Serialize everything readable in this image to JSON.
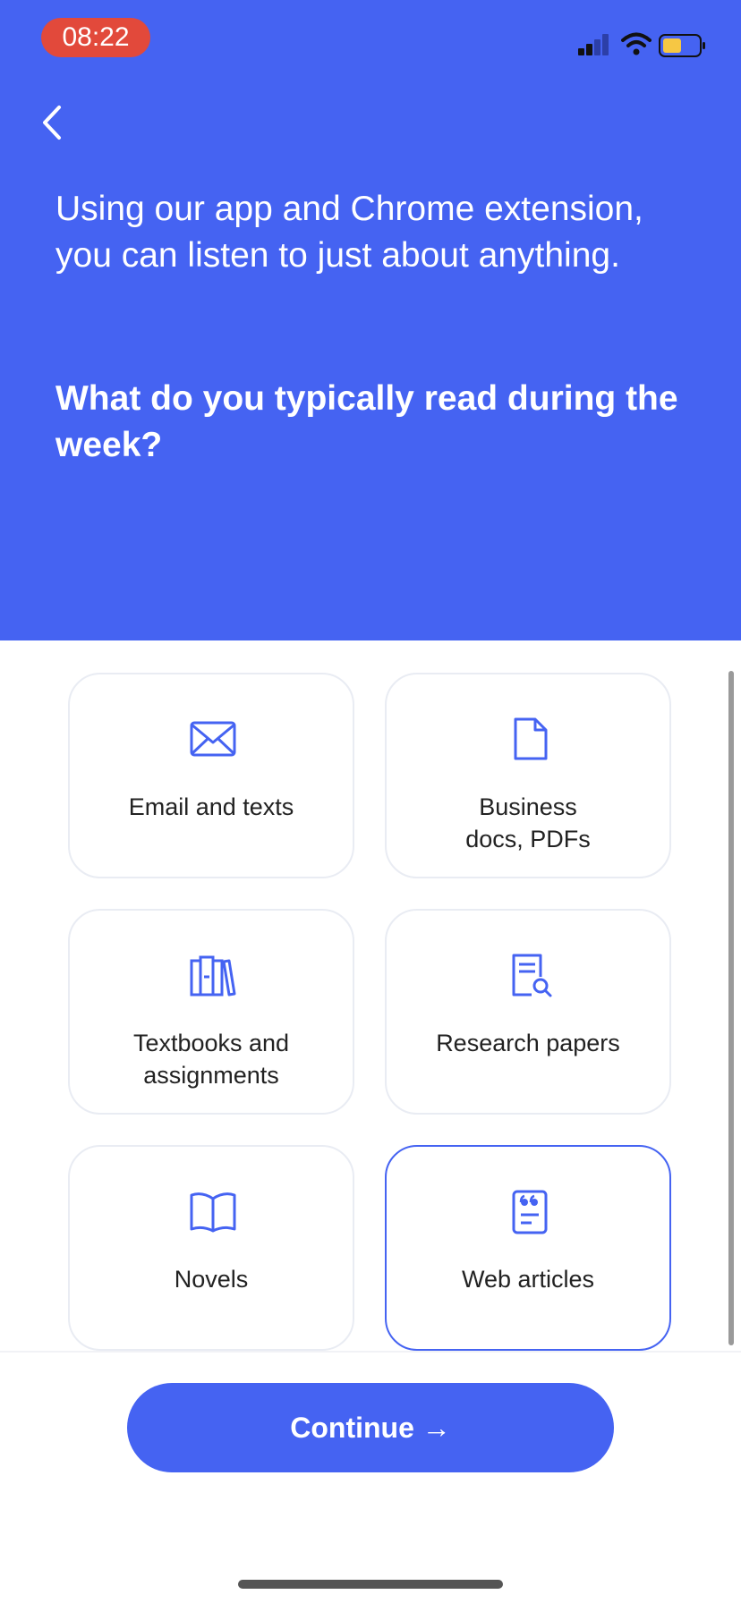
{
  "status": {
    "time": "08:22"
  },
  "header": {
    "intro": "Using our app and Chrome extension, you can listen to just about anything.",
    "question": "What do you typically read during the week?"
  },
  "options": [
    {
      "label": "Email and texts",
      "icon": "envelope-icon",
      "selected": false
    },
    {
      "label": "Business docs, PDFs",
      "icon": "document-icon",
      "selected": false
    },
    {
      "label": "Textbooks and assignments",
      "icon": "books-icon",
      "selected": false
    },
    {
      "label": "Research papers",
      "icon": "paper-search-icon",
      "selected": false
    },
    {
      "label": "Novels",
      "icon": "open-book-icon",
      "selected": false
    },
    {
      "label": "Web articles",
      "icon": "quote-article-icon",
      "selected": true
    }
  ],
  "continue_label": "Continue →",
  "colors": {
    "accent": "#4563f2",
    "time_badge": "#e2493b",
    "battery": "#f6c744"
  }
}
